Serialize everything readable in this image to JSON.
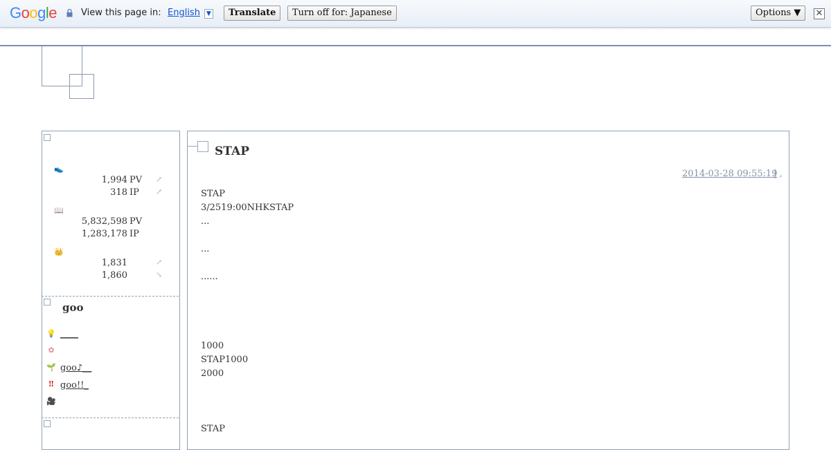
{
  "translate_bar": {
    "logo": "Google",
    "view_text": "View this page in:",
    "language": "English",
    "translate_button": "Translate",
    "turn_off_button": "Turn off for: Japanese",
    "options_button": "Options ▼",
    "close": "✕"
  },
  "sidebar": {
    "access": {
      "today_pv": "1,994",
      "today_pv_unit": "PV",
      "today_ip": "318",
      "today_ip_unit": "IP",
      "total_pv": "5,832,598",
      "total_pv_unit": "PV",
      "total_ip": "1,283,178",
      "total_ip_unit": "IP",
      "rank_1": "1,831",
      "rank_2": "1,860"
    },
    "goo_title": "goo",
    "goo_links": [
      "____",
      "",
      "goo♪__",
      "goo!!_",
      ""
    ]
  },
  "post": {
    "title": "STAP",
    "date": "2014-03-28 09:55:19",
    "date_sep": "| ,",
    "lines": [
      "STAP",
      "3/2519:00NHKSTAP",
      "...",
      "...",
      "......",
      "1000",
      "STAP1000",
      "2000",
      "STAP"
    ]
  }
}
